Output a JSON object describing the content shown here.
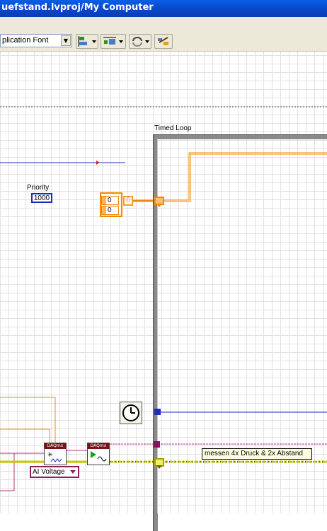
{
  "window": {
    "title": "uefstand.lvproj/My Computer"
  },
  "toolbar": {
    "font_select": "plication Font",
    "font_select_arrow": "▼"
  },
  "diagram": {
    "timed_loop_label": "Timed Loop",
    "priority_label": "Priority",
    "priority_value": "1000",
    "cluster_values": [
      "0",
      "0"
    ],
    "array_index_value": "0",
    "daq_create_header": "DAQmx",
    "daq_start_header": "DAQmx",
    "channel_type": "AI Voltage",
    "comment": "messen 4x Druck & 2x Abstand"
  },
  "colors": {
    "title_bar": "#0a4fd8",
    "wire_blue": "#1a2db8",
    "wire_orange": "#f08a00",
    "wire_pink": "#b03080",
    "wire_yellow": "#c8c800",
    "loop_border": "#8a8a8a"
  }
}
